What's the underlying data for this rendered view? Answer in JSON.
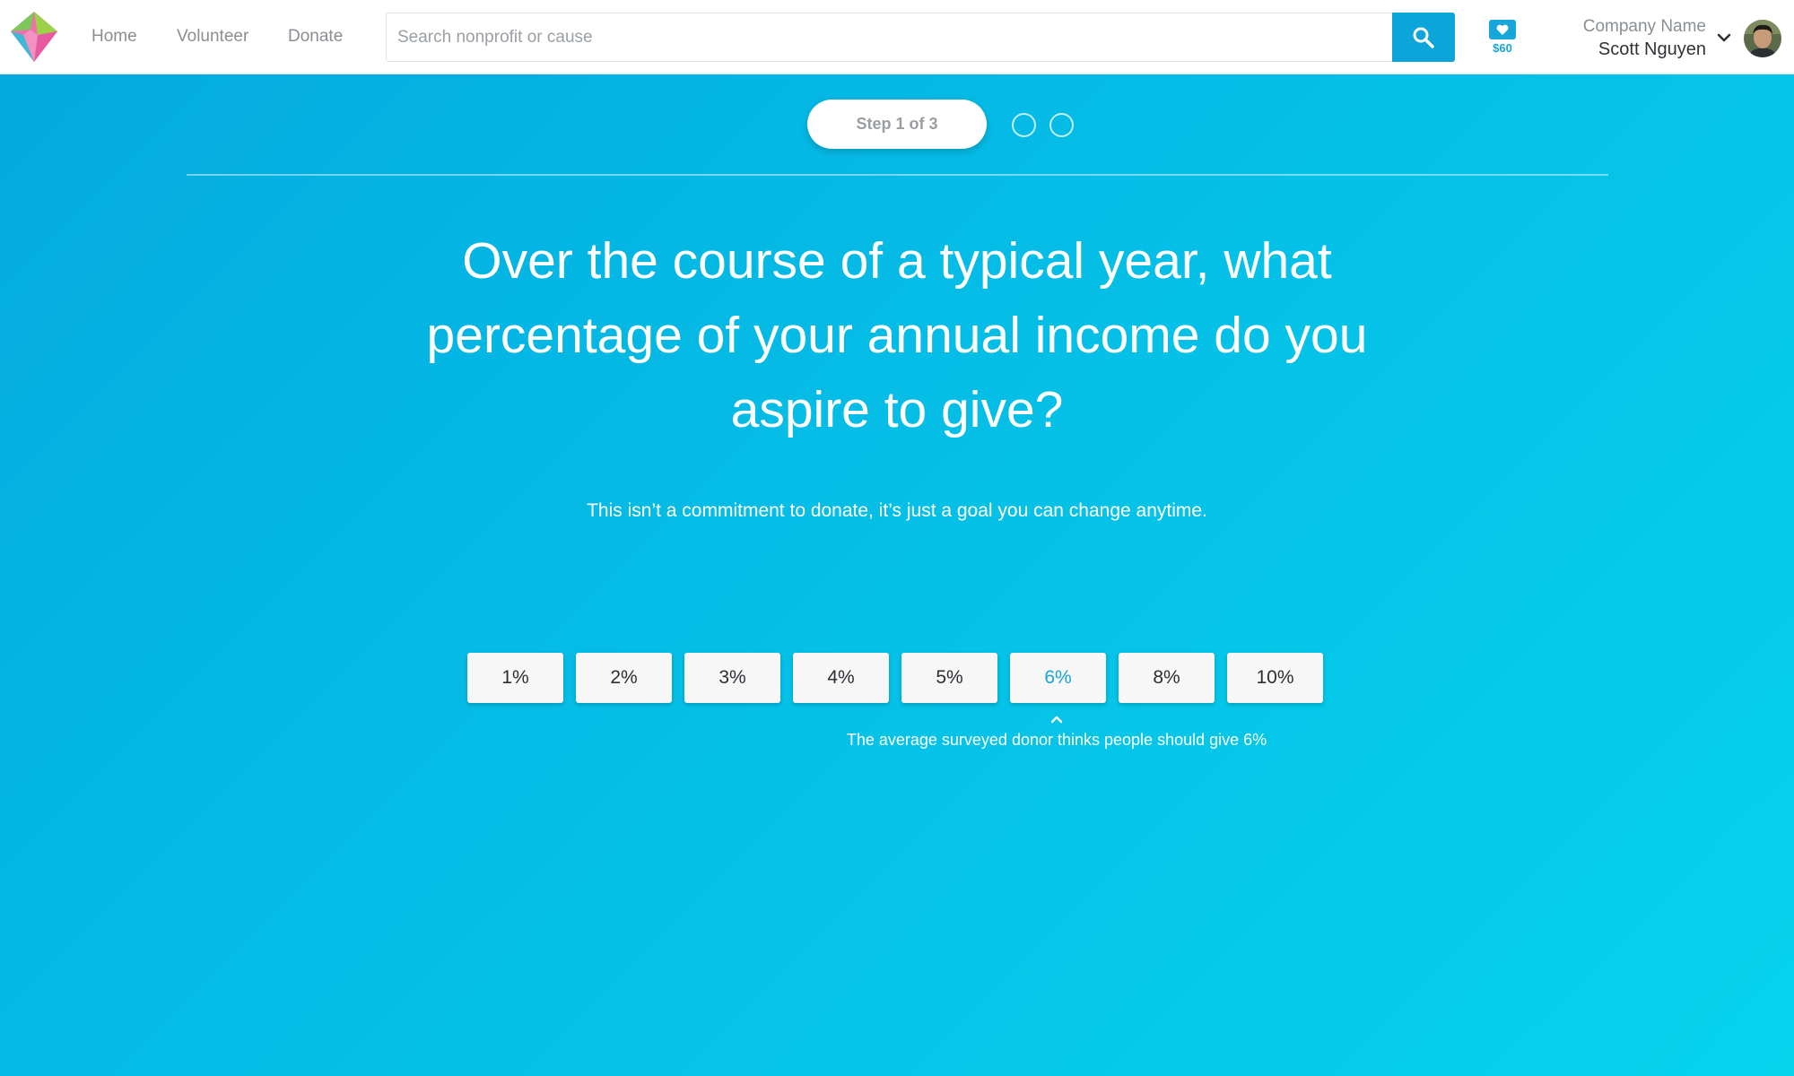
{
  "brand": {
    "logo_icon": "diamond-logo-icon",
    "colors": {
      "accent": "#0ba5da",
      "background_start": "#03a9de",
      "background_end": "#05d3ec",
      "header_bg": "#ffffff"
    }
  },
  "nav": {
    "items": [
      {
        "label": "Home"
      },
      {
        "label": "Volunteer"
      },
      {
        "label": "Donate"
      }
    ]
  },
  "search": {
    "placeholder": "Search nonprofit or cause",
    "value": "",
    "button_icon": "search-icon"
  },
  "wallet": {
    "icon": "heart-wallet-icon",
    "amount": "$60"
  },
  "account": {
    "company": "Company Name",
    "user": "Scott Nguyen",
    "menu_icon": "chevron-down-icon"
  },
  "stepper": {
    "label": "Step 1 of 3",
    "current_step": 1,
    "total_steps": 3
  },
  "question": {
    "text": "Over the course of a typical year, what percentage of your annual income do you aspire to give?",
    "subtitle": "This isn’t a commitment to donate, it’s just a goal you can change anytime."
  },
  "options": [
    {
      "label": "1%"
    },
    {
      "label": "2%"
    },
    {
      "label": "3%"
    },
    {
      "label": "4%"
    },
    {
      "label": "5%"
    },
    {
      "label": "6%",
      "highlighted": true
    },
    {
      "label": "8%"
    },
    {
      "label": "10%"
    }
  ],
  "average_note": "The average surveyed donor thinks people should give 6%"
}
